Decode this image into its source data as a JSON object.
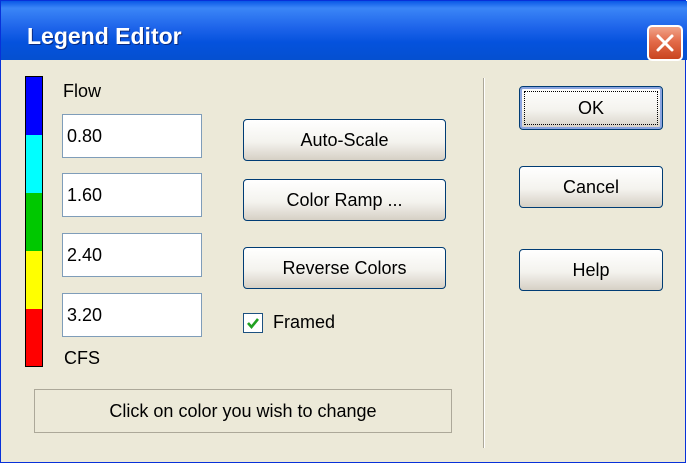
{
  "window": {
    "title": "Legend Editor"
  },
  "legend": {
    "name_label": "Flow",
    "units_label": "CFS",
    "colors": [
      "#0000FF",
      "#00FFFF",
      "#00C800",
      "#FFFF00",
      "#FF0000"
    ],
    "breakpoints": [
      "0.80",
      "1.60",
      "2.40",
      "3.20"
    ]
  },
  "buttons": {
    "auto_scale": "Auto-Scale",
    "color_ramp": "Color Ramp ...",
    "reverse_colors": "Reverse Colors",
    "ok": "OK",
    "cancel": "Cancel",
    "help": "Help"
  },
  "framed": {
    "label": "Framed",
    "checked": true
  },
  "status": "Click on color you wish to change"
}
